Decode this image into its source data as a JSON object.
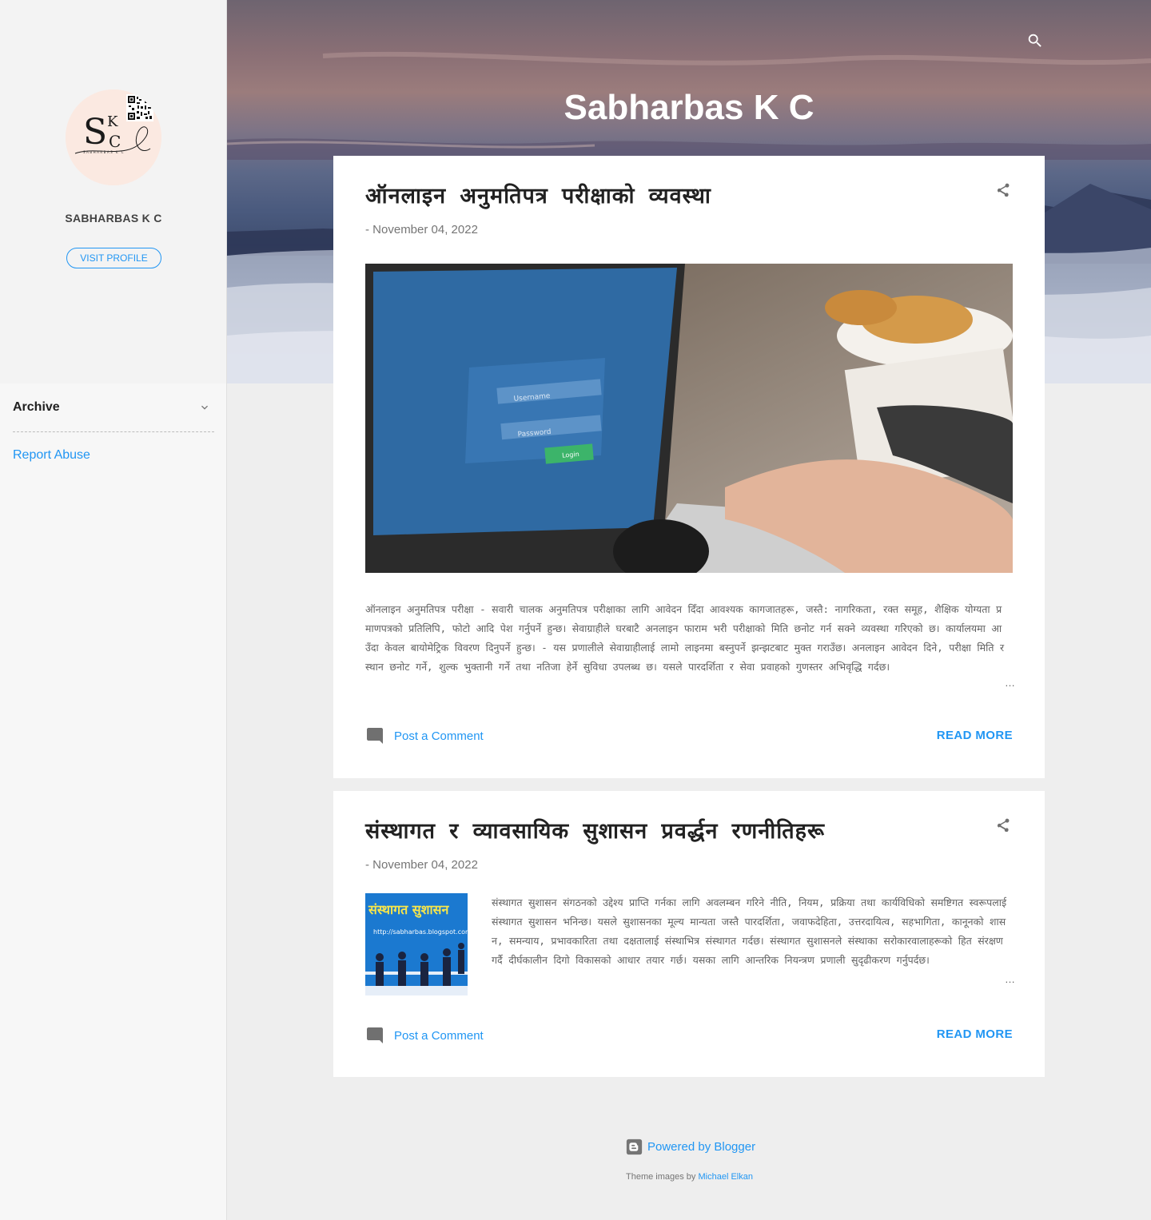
{
  "sidebar": {
    "profile_name": "SABHARBAS K C",
    "visit_profile": "VISIT PROFILE",
    "archive_label": "Archive",
    "report_abuse": "Report Abuse",
    "avatar_letters": [
      "S",
      "K",
      "C"
    ],
    "avatar_caption": "SABHARBAS K C"
  },
  "header": {
    "title": "Sabharbas K C",
    "search_icon": "search-icon"
  },
  "posts": [
    {
      "title": "ऑनलाइन अनुमतिपत्र परीक्षाको व्यवस्था",
      "date": "November 04, 2022",
      "date_prefix": "-",
      "image_labels": [
        "Username",
        "Password",
        "Login"
      ],
      "snippet": "  ऑनलाइन अनुमतिपत्र परीक्षा -  सवारी चालक अनुमतिपत्र परीक्षाका लागि आवेदन दिँदा आवश्यक कागजातहरू, जस्तै: नागरिकता, रक्त समूह, शैक्षिक योग्यता प्रमाणपत्रको प्रतिलिपि, फोटो आदि पेश गर्नुपर्ने हुन्छ। सेवाग्राहीले घरबाटै अनलाइन फाराम भरी परीक्षाको मिति छनोट गर्न सक्ने व्यवस्था गरिएको छ। कार्यालयमा आउँदा केवल बायोमेट्रिक विवरण दिनुपर्ने हुन्छ। - यस प्रणालीले सेवाग्राहीलाई लामो लाइनमा बस्नुपर्ने झन्झटबाट मुक्त गराउँछ। अनलाइन आवेदन दिने, परीक्षा मिति र स्थान छनोट गर्ने, शुल्क भुक्तानी गर्ने तथा नतिजा हेर्ने सुविधा उपलब्ध छ। यसले पारदर्शिता र सेवा प्रवाहको गुणस्तर अभिवृद्धि गर्दछ।",
      "comment_label": "Post a Comment",
      "read_more": "READ MORE"
    },
    {
      "title": "संस्थागत र व्यावसायिक सुशासन प्रवर्द्धन रणनीतिहरू",
      "date": "November 04, 2022",
      "date_prefix": "-",
      "thumb_title": "संस्थागत सुशासन",
      "thumb_url": "http://sabharbas.blogspot.com",
      "snippet": "संस्थागत सुशासन   संगठनको उद्देश्य प्राप्ति गर्नका लागि अवलम्बन गरिने नीति, नियम, प्रक्रिया तथा कार्यविधिको समष्टिगत स्वरूपलाई संस्थागत सुशासन भनिन्छ। यसले सुशासनका मूल्य मान्यता जस्तै पारदर्शिता, जवाफदेहिता, उत्तरदायित्व, सहभागिता, कानूनको शासन, समन्याय, प्रभावकारिता तथा दक्षतालाई संस्थाभित्र संस्थागत गर्दछ। संस्थागत सुशासनले संस्थाका सरोकारवालाहरूको हित संरक्षण गर्दै दीर्घकालीन दिगो विकासको आधार तयार गर्छ। यसका लागि आन्तरिक नियन्त्रण प्रणाली सुदृढीकरण गर्नुपर्दछ।",
      "comment_label": "Post a Comment",
      "read_more": "READ MORE"
    }
  ],
  "footer": {
    "powered_by": "Powered by Blogger",
    "theme_prefix": "Theme images by",
    "theme_author": "Michael Elkan"
  },
  "colors": {
    "accent": "#2196f3",
    "page_bg": "#eeeeee",
    "card_bg": "#ffffff",
    "sidebar_bg": "#f7f7f7"
  }
}
